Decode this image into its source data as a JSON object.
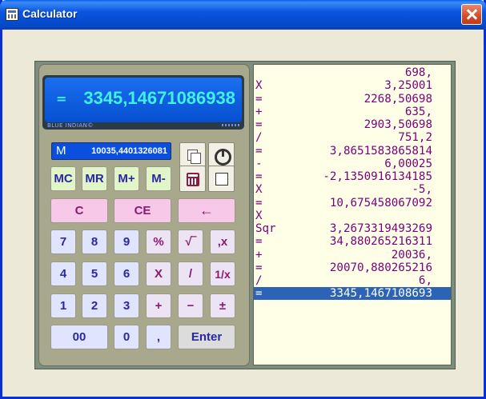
{
  "window": {
    "title": "Calculator"
  },
  "display": {
    "operator": "=",
    "value": "3345,14671086938",
    "brand": "BLUE INDIAN©"
  },
  "memory": {
    "label": "M",
    "value": "10035,4401326081"
  },
  "keys": {
    "mc": "MC",
    "mr": "MR",
    "mplus": "M+",
    "mminus": "M-",
    "c": "C",
    "ce": "CE",
    "back": "←",
    "k7": "7",
    "k8": "8",
    "k9": "9",
    "pct": "%",
    "sqrt": "√‾",
    "dpx": ",x",
    "k4": "4",
    "k5": "5",
    "k6": "6",
    "mul": "X",
    "div": "/",
    "inv": "1/x",
    "k1": "1",
    "k2": "2",
    "k3": "3",
    "add": "+",
    "sub": "−",
    "neg": "±",
    "k00": "00",
    "k0": "0",
    "comma": ",",
    "enter": "Enter"
  },
  "tape": [
    {
      "op": "",
      "val": "698,"
    },
    {
      "op": "X",
      "val": "3,25001"
    },
    {
      "op": "=",
      "val": "2268,50698"
    },
    {
      "op": "+",
      "val": "635,"
    },
    {
      "op": "=",
      "val": "2903,50698"
    },
    {
      "op": "/",
      "val": "751,2"
    },
    {
      "op": "=",
      "val": "3,8651583865814"
    },
    {
      "op": "-",
      "val": "6,00025"
    },
    {
      "op": "=",
      "val": "-2,1350916134185"
    },
    {
      "op": "X",
      "val": "-5,"
    },
    {
      "op": "=",
      "val": "10,675458067092"
    },
    {
      "op": "X",
      "val": ""
    },
    {
      "op": "Sqr",
      "val": "3,2673319493269"
    },
    {
      "op": "=",
      "val": "34,880265216311"
    },
    {
      "op": "+",
      "val": "20036,"
    },
    {
      "op": "=",
      "val": "20070,880265216"
    },
    {
      "op": "/",
      "val": "6,"
    },
    {
      "op": "=",
      "val": "3345,1467108693"
    }
  ]
}
